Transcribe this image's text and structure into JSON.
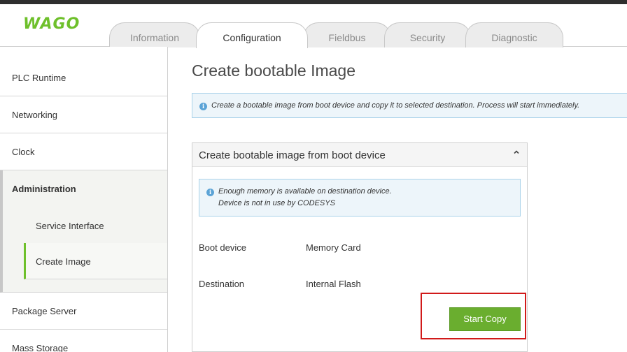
{
  "brand": {
    "logo_text": "WAGO",
    "accent_color": "#6ec02b",
    "button_color": "#6aae2f",
    "highlight_color": "#d11a1a"
  },
  "tabs": [
    {
      "label": "Information",
      "active": false
    },
    {
      "label": "Configuration",
      "active": true
    },
    {
      "label": "Fieldbus",
      "active": false
    },
    {
      "label": "Security",
      "active": false
    },
    {
      "label": "Diagnostic",
      "active": false
    }
  ],
  "sidebar": {
    "items": [
      {
        "label": "PLC Runtime"
      },
      {
        "label": "Networking"
      },
      {
        "label": "Clock"
      },
      {
        "label": "Administration",
        "expanded": true
      },
      {
        "label": "Package Server"
      },
      {
        "label": "Mass Storage"
      }
    ],
    "administration_children": [
      {
        "label": "Service Interface",
        "active": false
      },
      {
        "label": "Create Image",
        "active": true
      }
    ]
  },
  "main": {
    "page_title": "Create bootable Image",
    "info_message": "Create a bootable image from boot device and copy it to selected destination. Process will start immediately.",
    "panel": {
      "title": "Create bootable image from boot device",
      "collapse_icon": "chevron-up-icon",
      "status_lines": [
        "Enough memory is available on destination device.",
        "Device is not in use by CODESYS"
      ],
      "fields": [
        {
          "label": "Boot device",
          "value": "Memory Card"
        },
        {
          "label": "Destination",
          "value": "Internal Flash"
        }
      ],
      "start_button_label": "Start Copy"
    }
  }
}
